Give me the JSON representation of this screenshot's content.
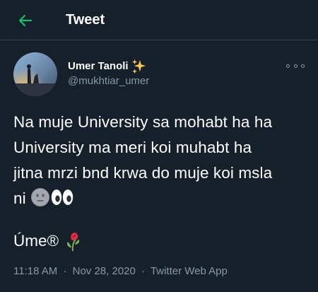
{
  "header": {
    "back_icon": "arrow-left-icon",
    "title": "Tweet",
    "accent_color": "#1da1f2",
    "back_color": "#17bf63"
  },
  "tweet": {
    "author": {
      "display_name": "Umer Tanoli",
      "name_emoji": "sparkles-icon",
      "handle": "@mukhtiar_umer"
    },
    "more_icon": "more-dots-icon",
    "text_lines": [
      "Na muje University sa mohabt ha ha",
      "University ma meri koi muhabt ha",
      "jitna mrzi bnd krwa do muje koi msla",
      "ni"
    ],
    "text_emojis": [
      "neutral-face-icon",
      "eyes-icon"
    ],
    "signature": "Úme®",
    "signature_emoji": "wilted-rose-icon",
    "time": "11:18 AM",
    "date": "Nov 28, 2020",
    "separator": "·",
    "source": "Twitter Web App"
  },
  "colors": {
    "background": "#15202b",
    "secondary_text": "#8899a6",
    "divider": "#38444d"
  }
}
